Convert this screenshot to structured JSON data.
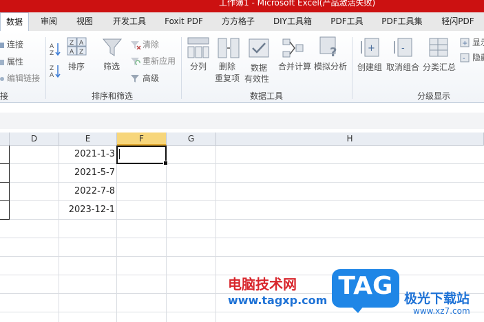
{
  "window": {
    "title": "工作簿1 - Microsoft Excel(产品激活失败)"
  },
  "tabs": [
    "数据",
    "审阅",
    "视图",
    "开发工具",
    "Foxit PDF",
    "方方格子",
    "DIY工具箱",
    "PDF工具",
    "PDF工具集",
    "轻闪PDF"
  ],
  "ribbon": {
    "connections": {
      "items": [
        "连接",
        "属性",
        "编辑链接"
      ],
      "group_label": "接"
    },
    "sort_filter": {
      "sort_label": "排序",
      "filter_label": "筛选",
      "clear_label": "清除",
      "reapply_label": "重新应用",
      "advanced_label": "高级",
      "group_label": "排序和筛选"
    },
    "data_tools": {
      "split_label": "分列",
      "remove_dup_label1": "删除",
      "remove_dup_label2": "重复项",
      "validation_label1": "数据",
      "validation_label2": "有效性",
      "consolidate_label": "合并计算",
      "whatif_label": "模拟分析",
      "group_label": "数据工具"
    },
    "outline": {
      "group_label1": "创建组",
      "ungroup_label": "取消组合",
      "subtotal_label": "分类汇总",
      "show_label": "显示",
      "hide_label": "隐藏",
      "group_label": "分级显示"
    }
  },
  "columns": [
    "D",
    "E",
    "F",
    "G",
    "H"
  ],
  "selected_column": "F",
  "cells": {
    "E": [
      "2021-1-3",
      "2021-5-7",
      "2022-7-8",
      "2023-12-1"
    ]
  },
  "watermark": {
    "site_cn": "电脑技术网",
    "site_url": "www.tagxp.com",
    "badge": "TAG",
    "brand_cn": "极光下载站",
    "brand_url": "www.xz7.com"
  },
  "colors": {
    "title_bar": "#cc1111",
    "selected_header": "#f7d67b",
    "tag_badge": "#1f86e6"
  }
}
